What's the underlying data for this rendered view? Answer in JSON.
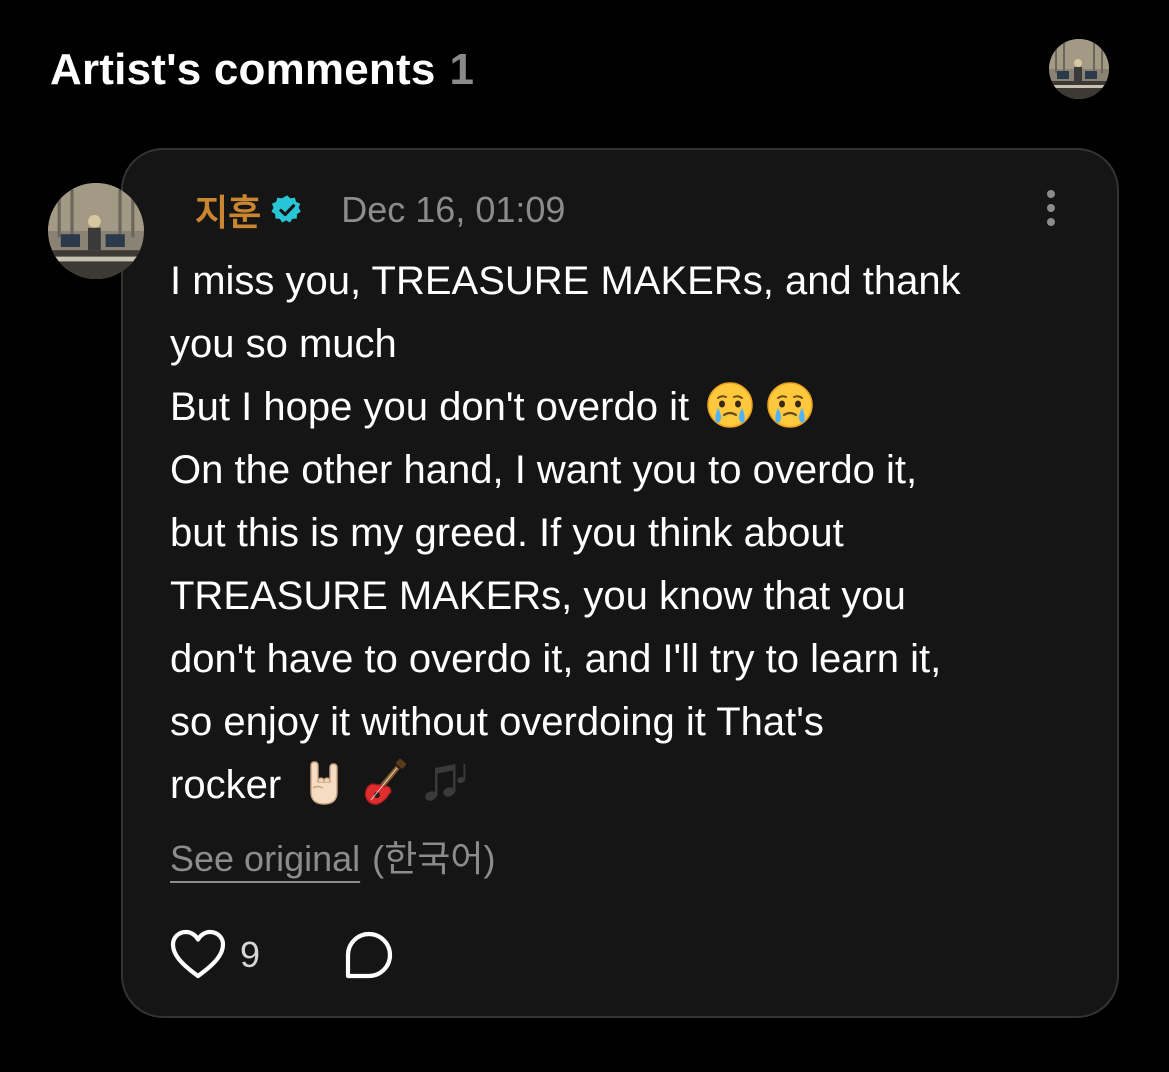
{
  "header": {
    "title": "Artist's comments",
    "count": "1"
  },
  "comment": {
    "author": "지훈",
    "timestamp": "Dec 16, 01:09",
    "lines": [
      "I miss you, TREASURE MAKERs, and thank",
      "you so much",
      "But I hope you don't overdo it",
      "On the other hand, I want you to overdo it,",
      "but this is my greed. If you think about",
      "TREASURE MAKERs, you know that you",
      "don't have to overdo it, and I'll try to learn it,",
      "so enjoy it without overdoing it That's",
      "rocker"
    ],
    "emojis": {
      "line3": [
        "face-holding-back-tears",
        "face-holding-back-tears"
      ],
      "line9": [
        "sign-of-the-horns",
        "guitar",
        "musical-notes"
      ]
    },
    "see_original": "See original",
    "language": "(한국어)",
    "like_count": "9"
  },
  "colors": {
    "background": "#000000",
    "card": "#151515",
    "card_border": "#333333",
    "author": "#c9852f",
    "verified": "#29c4d6",
    "muted": "#8c8c8c"
  },
  "icons": {
    "verified": "verified-badge-icon",
    "more": "more-vertical-icon",
    "like": "heart-icon",
    "reply": "speech-bubble-icon"
  }
}
